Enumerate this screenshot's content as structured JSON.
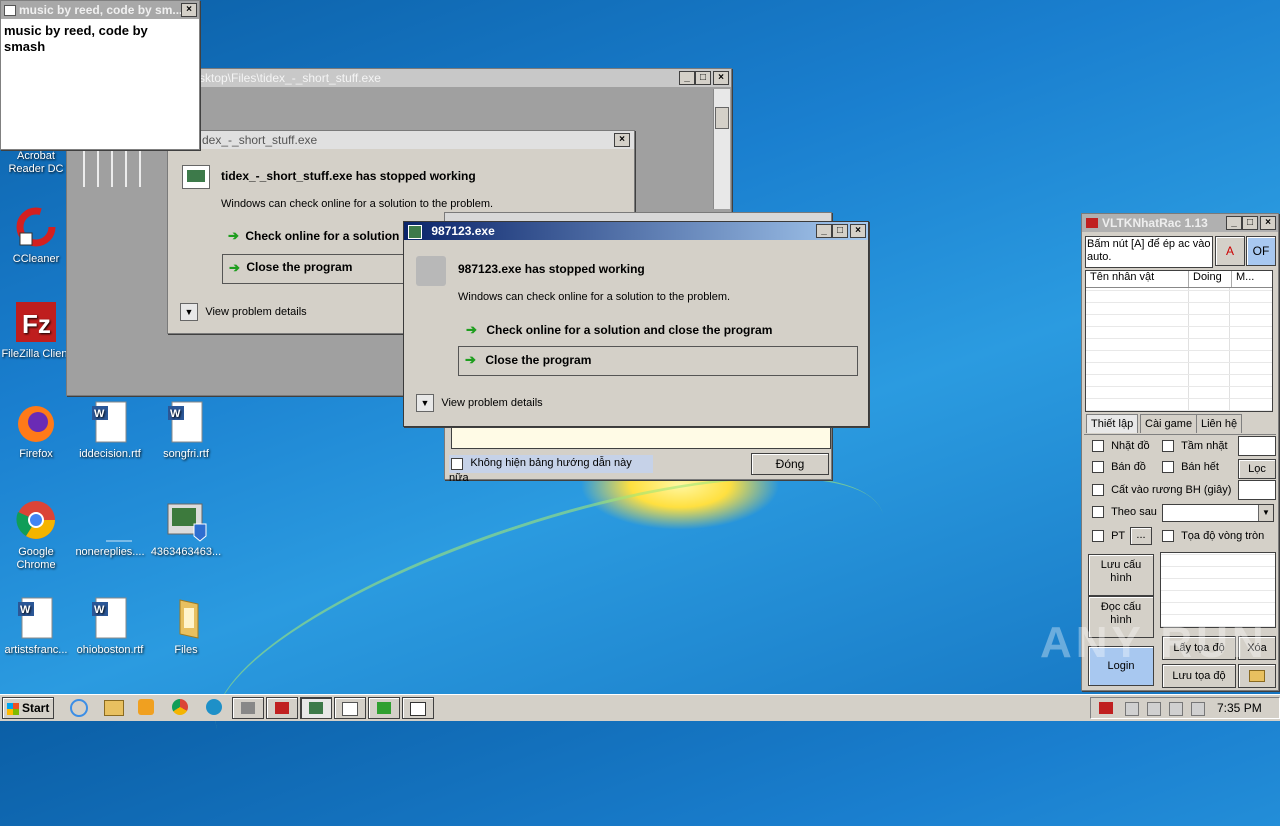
{
  "desktop": {
    "icons": [
      {
        "label": "Acrobat Reader DC",
        "icon": "acrobat-icon"
      },
      {
        "label": "CCleaner",
        "icon": "ccleaner-icon"
      },
      {
        "label": "FileZilla Client",
        "icon": "filezilla-icon"
      },
      {
        "label": "Firefox",
        "icon": "firefox-icon"
      },
      {
        "label": "iddecision.rtf",
        "icon": "word-doc-icon"
      },
      {
        "label": "songfri.rtf",
        "icon": "word-doc-icon"
      },
      {
        "label": "Google Chrome",
        "icon": "chrome-icon"
      },
      {
        "label": "nonereplies....",
        "icon": "blank-file-icon"
      },
      {
        "label": "4363463463...",
        "icon": "installer-icon"
      },
      {
        "label": "artistsfranc...",
        "icon": "word-doc-icon"
      },
      {
        "label": "ohioboston.rtf",
        "icon": "word-doc-icon"
      },
      {
        "label": "Files",
        "icon": "folder-icon"
      }
    ]
  },
  "smash_window": {
    "title": "music by reed, code by sm...",
    "body": "music by reed, code by smash"
  },
  "explorer_window": {
    "title": "sktop\\Files\\tidex_-_short_stuff.exe"
  },
  "tidex_dialog": {
    "title": "dex_-_short_stuff.exe",
    "heading": "tidex_-_short_stuff.exe has stopped working",
    "subtext": "Windows can check online for a solution to the problem.",
    "option1": "Check online for a solution",
    "option2": "Close the program",
    "details": "View problem details"
  },
  "main_dialog": {
    "title": "987123.exe",
    "heading": "987123.exe has stopped working",
    "subtext": "Windows can check online for a solution to the problem.",
    "option1": "Check online for a solution and close the program",
    "option2": "Close the program",
    "details": "View problem details"
  },
  "behind_dialog": {
    "checkbox_label": "Không hiện bảng hướng dẫn này nữa",
    "close_button": "Đóng"
  },
  "vltk": {
    "title": "VLTKNhatRac 1.13",
    "instruction": "Bấm nút [A] để ép ac vào auto.",
    "btn_a": "A",
    "btn_of": "OF",
    "columns": [
      "Tên nhân vật",
      "Doing",
      "M..."
    ],
    "tabs": [
      "Thiết lập",
      "Cài game",
      "Liên hệ"
    ],
    "nhat_do": "Nhặt đồ",
    "tam_nhat": "Tầm nhặt",
    "ban_do": "Bán đồ",
    "ban_het": "Bán hết",
    "loc": "Lọc",
    "cat_vao": "Cất vào rương BH (giây)",
    "theo_sau": "Theo sau",
    "pt": "PT",
    "pt_btn": "...",
    "toa_do_vong_tron": "Tọa độ vòng tròn",
    "luu_cau_hinh": "Lưu cấu hình",
    "doc_cau_hinh": "Đọc cấu hình",
    "lay_toa_do": "Lấy tọa độ",
    "xoa": "Xóa",
    "login": "Login",
    "luu_toa_do": "Lưu tọa độ"
  },
  "taskbar": {
    "start_label": "Start",
    "clock": "7:35 PM"
  },
  "watermark": "ANY RUN"
}
